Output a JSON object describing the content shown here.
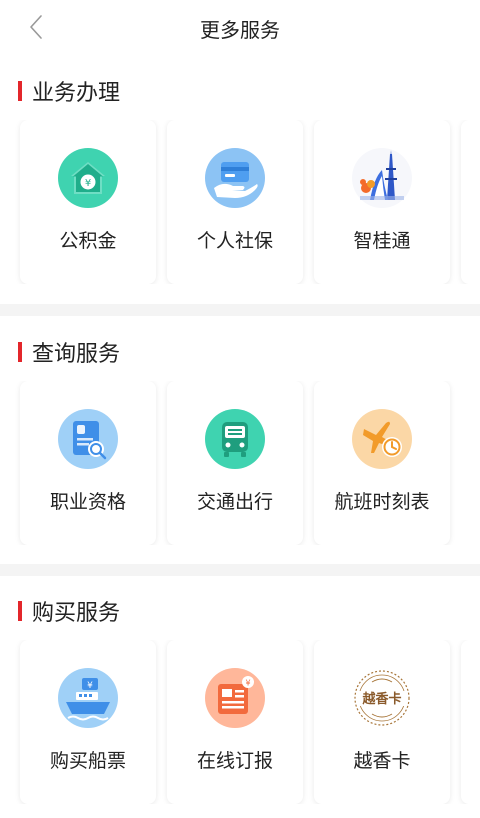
{
  "header": {
    "title": "更多服务",
    "back_icon": "chevron-left-icon"
  },
  "sections": [
    {
      "title": "业务办理",
      "items": [
        {
          "label": "公积金",
          "icon": "housing-fund-icon"
        },
        {
          "label": "个人社保",
          "icon": "social-security-card-icon"
        },
        {
          "label": "智桂通",
          "icon": "zhiguitong-landmark-icon"
        }
      ]
    },
    {
      "title": "查询服务",
      "items": [
        {
          "label": "职业资格",
          "icon": "document-search-icon"
        },
        {
          "label": "交通出行",
          "icon": "bus-icon"
        },
        {
          "label": "航班时刻表",
          "icon": "airplane-clock-icon"
        }
      ]
    },
    {
      "title": "购买服务",
      "items": [
        {
          "label": "购买船票",
          "icon": "ship-ticket-icon"
        },
        {
          "label": "在线订报",
          "icon": "newspaper-icon"
        },
        {
          "label": "越香卡",
          "icon": "yuexiangka-logo"
        }
      ]
    }
  ],
  "colors": {
    "accent": "#e3262b",
    "divider": "#f4f4f4"
  }
}
